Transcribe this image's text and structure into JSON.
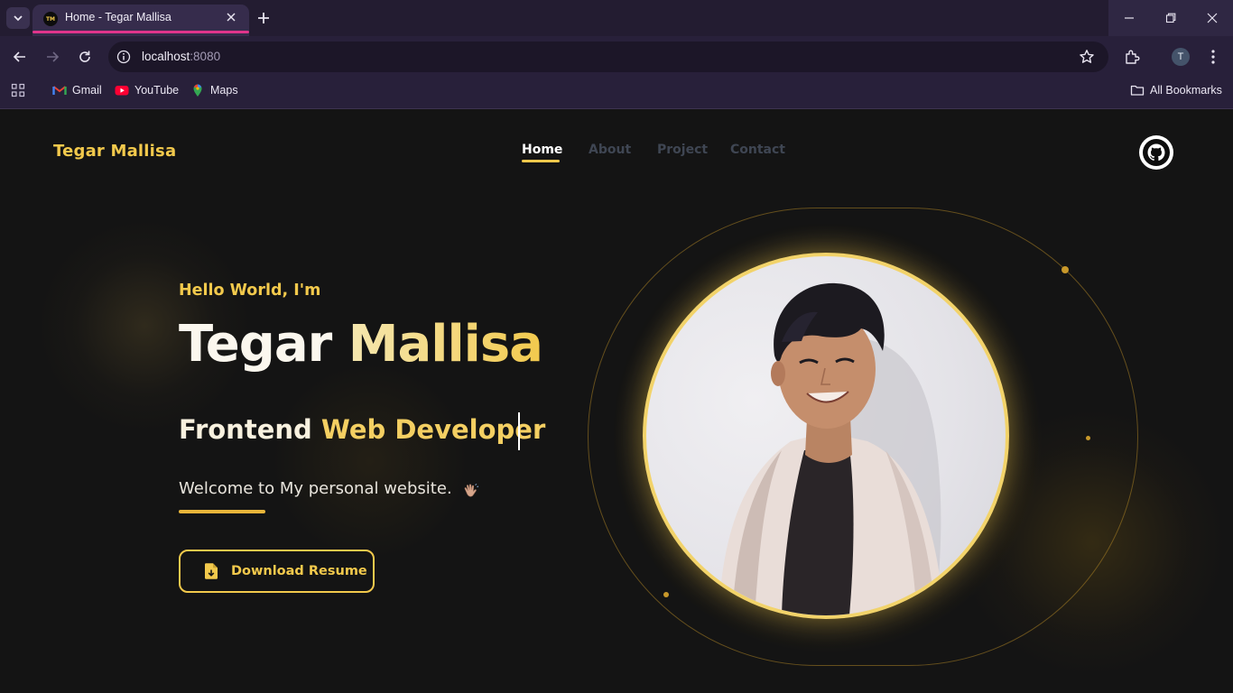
{
  "browser": {
    "tab": {
      "favicon_text": "TM",
      "title": "Home - Tegar Mallisa"
    },
    "url": {
      "host": "localhost",
      "port": ":8080"
    },
    "profile_initial": "T",
    "bookmarks": [
      {
        "label": "Gmail",
        "icon": "gmail-icon"
      },
      {
        "label": "YouTube",
        "icon": "youtube-icon"
      },
      {
        "label": "Maps",
        "icon": "maps-icon"
      }
    ],
    "all_bookmarks": "All Bookmarks"
  },
  "site": {
    "brand": "Tegar Mallisa",
    "nav": [
      {
        "label": "Home",
        "active": true
      },
      {
        "label": "About",
        "active": false
      },
      {
        "label": "Project",
        "active": false
      },
      {
        "label": "Contact",
        "active": false
      }
    ],
    "github_icon": "github-icon"
  },
  "hero": {
    "greeting": "Hello World, I'm",
    "name_first": "Tegar",
    "name_last": "Mallisa",
    "role_a": "Frontend",
    "role_b": "Web Developer",
    "welcome": "Welcome to My personal website.",
    "download_label": "Download Resume",
    "photo_alt": "Tegar Mallisa portrait"
  },
  "colors": {
    "accent": "#f2c94c",
    "background": "#141414",
    "chrome": "#28203a",
    "tab_indicator": "#e0348b"
  }
}
